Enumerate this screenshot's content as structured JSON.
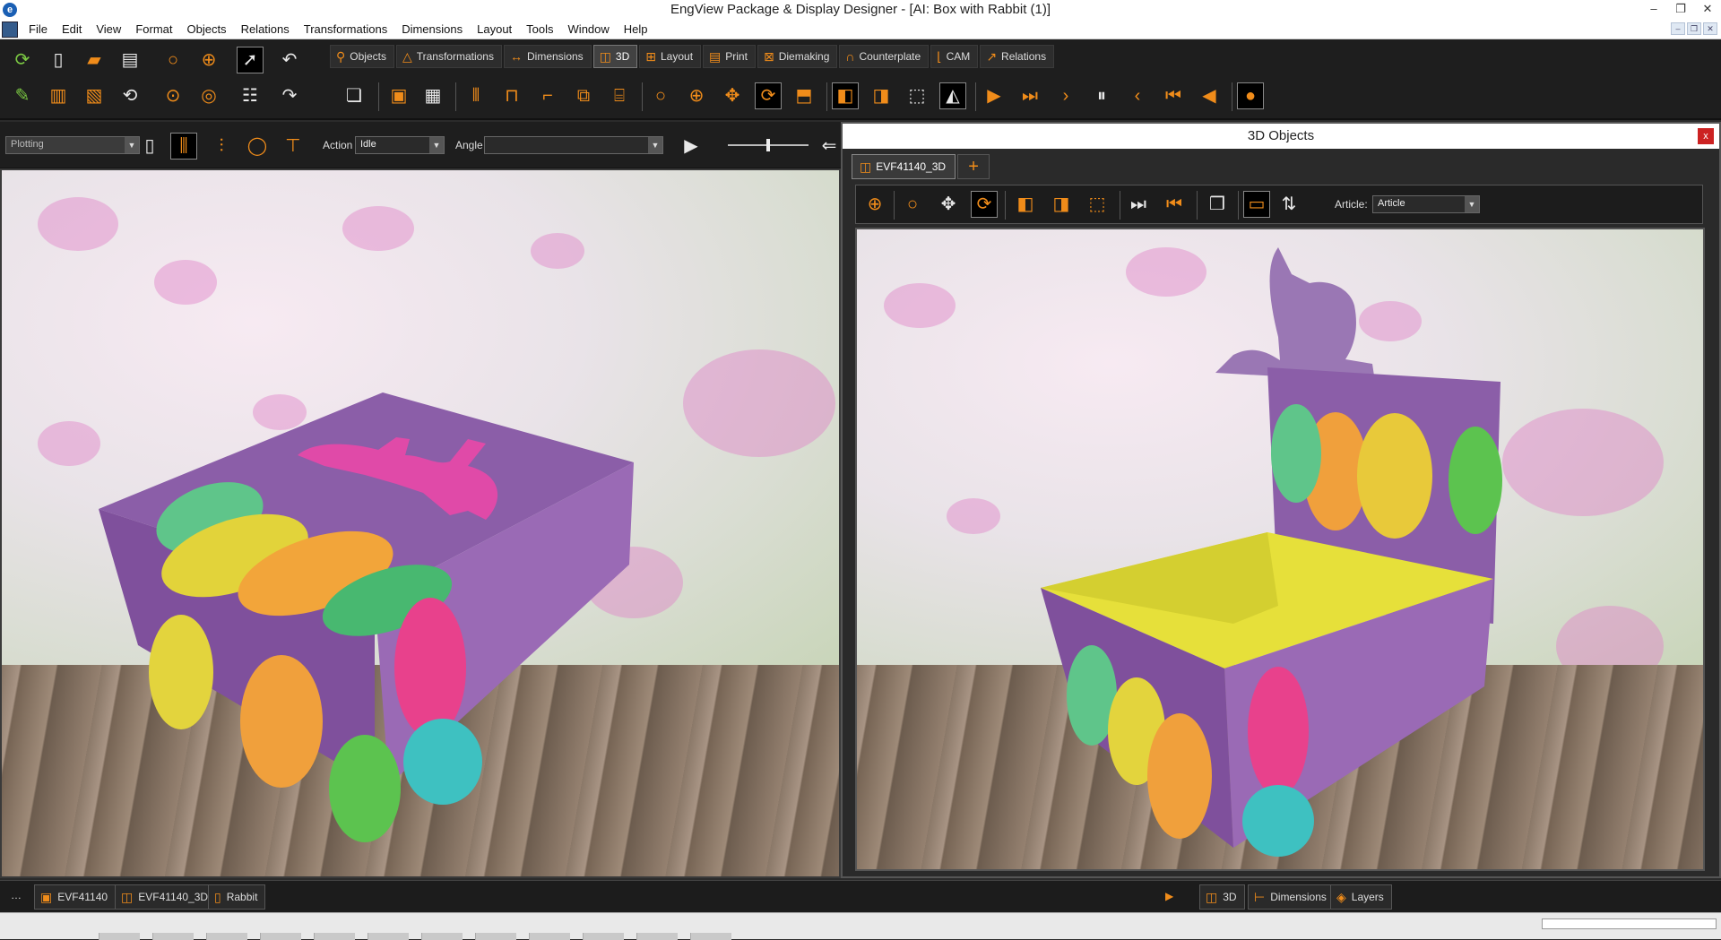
{
  "window": {
    "title": "EngView Package & Display Designer - [AI: Box with Rabbit (1)]",
    "controls": [
      "–",
      "❐",
      "✕"
    ]
  },
  "menu": [
    "File",
    "Edit",
    "View",
    "Format",
    "Objects",
    "Relations",
    "Transformations",
    "Dimensions",
    "Layout",
    "Tools",
    "Window",
    "Help"
  ],
  "tabs": [
    {
      "label": "Objects",
      "icon": "pin-icon"
    },
    {
      "label": "Transformations",
      "icon": "triangle-icon"
    },
    {
      "label": "Dimensions",
      "icon": "ruler-icon"
    },
    {
      "label": "3D",
      "icon": "cube-icon",
      "active": true
    },
    {
      "label": "Layout",
      "icon": "grid-icon"
    },
    {
      "label": "Print",
      "icon": "print-icon"
    },
    {
      "label": "Diemaking",
      "icon": "die-icon"
    },
    {
      "label": "Counterplate",
      "icon": "counterplate-icon"
    },
    {
      "label": "CAM",
      "icon": "cam-icon"
    },
    {
      "label": "Relations",
      "icon": "relations-icon"
    }
  ],
  "options": {
    "mode_value": "Plotting",
    "action_label": "Action",
    "action_value": "Idle",
    "angle_label": "Angle",
    "angle_value": ""
  },
  "panel": {
    "title": "3D Objects",
    "close": "x",
    "tab_label": "EVF41140_3D",
    "add_tab": "+",
    "article_label": "Article:",
    "article_value": "Article"
  },
  "status_tabs_left": [
    {
      "label": "EVF41140"
    },
    {
      "label": "EVF41140_3D"
    },
    {
      "label": "Rabbit"
    }
  ],
  "status_tabs_right": [
    {
      "label": "3D"
    },
    {
      "label": "Dimensions"
    },
    {
      "label": "Layers"
    }
  ],
  "status_more": "…",
  "status_arrow": "▶",
  "colors": {
    "accent": "#f08c1a",
    "box_purple": "#8b5ea8",
    "inner_yellow": "#e6e03a",
    "bunny_pink": "#e04aa8"
  }
}
